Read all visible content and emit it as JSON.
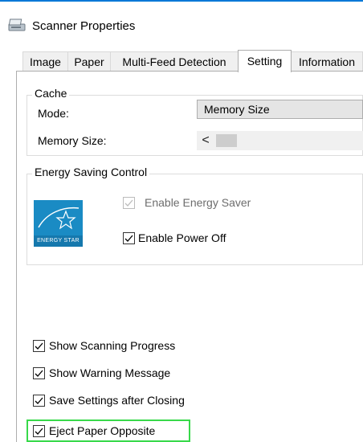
{
  "window": {
    "title": "Scanner Properties",
    "icon": "scanner-icon"
  },
  "tabs": [
    {
      "label": "Image"
    },
    {
      "label": "Paper"
    },
    {
      "label": "Multi-Feed Detection"
    },
    {
      "label": "Setting"
    },
    {
      "label": "Information"
    }
  ],
  "active_tab": "Setting",
  "cache": {
    "group_label": "Cache",
    "mode_label": "Mode:",
    "mode_value": "Memory Size",
    "memory_size_label": "Memory Size:",
    "scroll_left_glyph": "<"
  },
  "energy": {
    "group_label": "Energy Saving Control",
    "logo_caption": "ENERGY STAR",
    "enable_energy_saver": {
      "label": "Enable Energy Saver",
      "checked": true,
      "disabled": true
    },
    "enable_power_off": {
      "label": "Enable Power Off",
      "checked": true
    }
  },
  "options": [
    {
      "label": "Show Scanning Progress",
      "checked": true
    },
    {
      "label": "Show Warning Message",
      "checked": true
    },
    {
      "label": "Save Settings after Closing",
      "checked": true
    },
    {
      "label": "Eject Paper Opposite",
      "checked": true,
      "highlighted": true
    }
  ],
  "colors": {
    "accent": "#0078d7",
    "highlight": "#38d94a",
    "energy_star": "#1a8bc4"
  }
}
